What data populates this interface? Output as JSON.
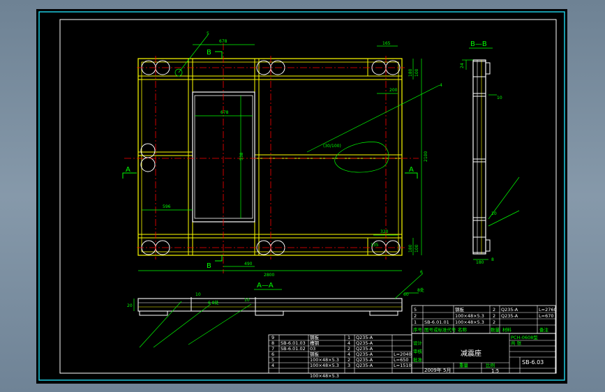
{
  "colors": {
    "background": "#000000",
    "frame": "#ffffff",
    "outer_frame": "#1ecbe0",
    "part": "#ffff00",
    "dimension": "#00ff00",
    "center_line": "#ff0000",
    "hatch": "#ffffff"
  },
  "view_labels": {
    "section_bb_title": "B—B",
    "section_aa_title": "A—A",
    "section_a": "A",
    "section_b": "B"
  },
  "plan_dimensions": {
    "top_left": "678",
    "top_right": "165",
    "right_small": "200",
    "right_top_a": "180",
    "right_top_b": "100",
    "right_total": "2100",
    "inner_width": "678",
    "inner_height": "538",
    "left_span": "596",
    "bottom_inner": "490",
    "bottom_total": "2800",
    "bottom_right_a": "320",
    "bottom_right_b": "135",
    "bottom_right_c": "180",
    "bottom_right_d": "100",
    "weld_note": "(30/100)",
    "leader_5": "5",
    "leader_4": "4"
  },
  "section_bb_dimensions": {
    "top": "24",
    "bottom_a": "180",
    "bottom_b": "8",
    "right_a": "10",
    "right_b": "10"
  },
  "section_aa_dimensions": {
    "left": "20",
    "small_a": "10",
    "small_b": "10",
    "weld": "6 8处",
    "weld_b": "8处",
    "right": "60",
    "label_6": "6"
  },
  "bom": {
    "upper_rows": [
      {
        "no": "5",
        "code": "",
        "name": "钢板",
        "qty": "2",
        "material": "Q235-A",
        "note": "L=2760"
      },
      {
        "no": "2",
        "code": "",
        "name": "100×48×5.3",
        "qty": "2",
        "material": "Q235-A",
        "note": "L=670"
      },
      {
        "no": "1",
        "code": "SB-6.01.01",
        "name": "100×48×5.3",
        "qty": "2",
        "material": "",
        "note": ""
      }
    ],
    "upper_header": [
      "序号",
      "图号或标准代号",
      "名称",
      "数量",
      "材料",
      "备注"
    ],
    "lower_rows": [
      {
        "no": "9",
        "code": "",
        "name": "钢板",
        "qty": "1",
        "material": "Q235-A",
        "note": ""
      },
      {
        "no": "8",
        "code": "SB-6.01.03",
        "name": "槽钢",
        "qty": "4",
        "material": "Q235-A",
        "note": ""
      },
      {
        "no": "7",
        "code": "SB-6.01.02",
        "name": "03",
        "qty": "2",
        "material": "Q235-A",
        "note": ""
      },
      {
        "no": "6",
        "code": "",
        "name": "钢板",
        "qty": "4",
        "material": "Q235-A",
        "note": "L=2040"
      },
      {
        "no": "5",
        "code": "",
        "name": "100×48×5.3",
        "qty": "2",
        "material": "Q235-A",
        "note": "L=650"
      },
      {
        "no": "4",
        "code": "",
        "name": "100×48×5.3",
        "qty": "3",
        "material": "Q235-A",
        "note": "L=1510"
      }
    ],
    "lower_footer": "100×48×5.3"
  },
  "title_block": {
    "company": "PCH-0608型",
    "drawing_title": "减震座",
    "drawing_no": "SB-6.03",
    "scale": "1:5",
    "date": "2009年 5月",
    "label_weight": "重量",
    "label_scale": "比例",
    "label_sheet": "共 张",
    "label_design": "设计",
    "label_check": "审核",
    "label_approve": "批准"
  }
}
